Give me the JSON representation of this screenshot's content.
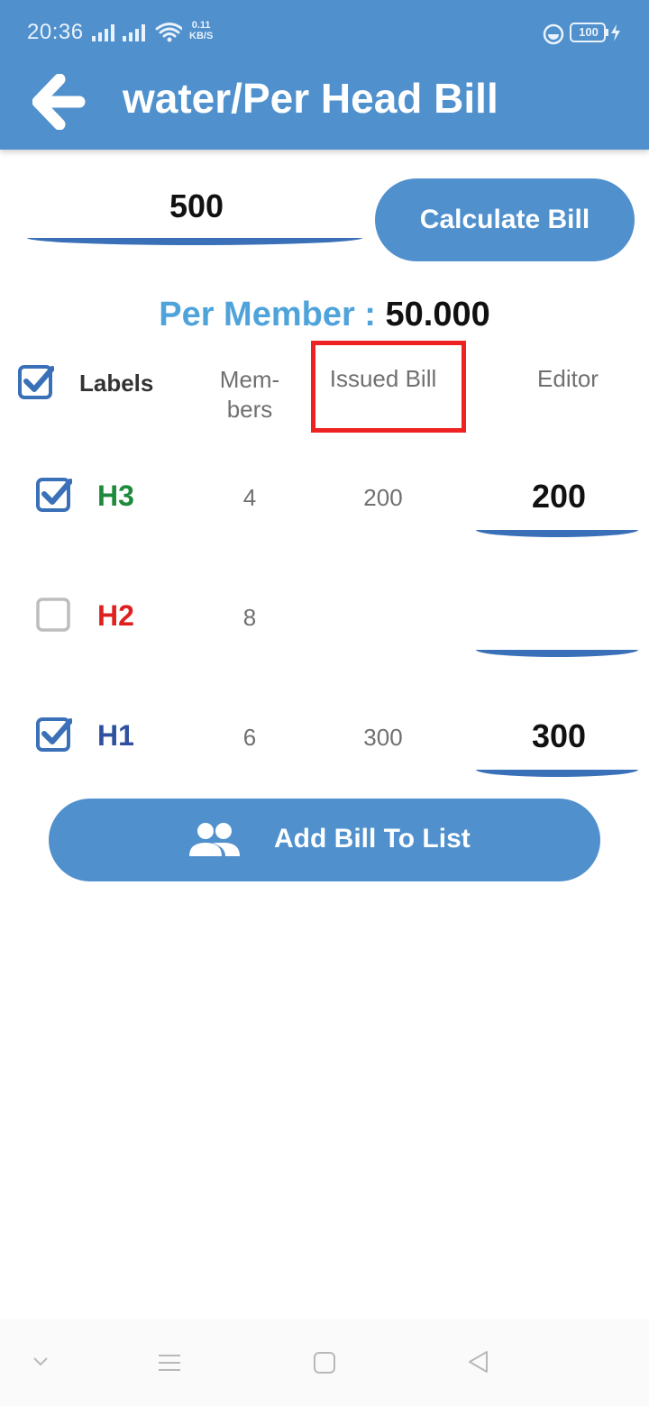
{
  "status_bar": {
    "time": "20:36",
    "speed_value": "0.11",
    "speed_unit": "KB/S",
    "battery": "100"
  },
  "app_bar": {
    "title": "water/Per Head Bill",
    "back_icon": "arrow-left-icon"
  },
  "bill_input": {
    "value": "500"
  },
  "calculate_button": {
    "label": "Calculate Bill"
  },
  "per_member": {
    "label": "Per Member : ",
    "value": "50.000"
  },
  "table_header": {
    "select_all_checked": true,
    "labels": "Labels",
    "members_line1": "Mem-",
    "members_line2": "bers",
    "issued_bill": "Issued Bill",
    "editor": "Editor"
  },
  "rows": [
    {
      "label": "H3",
      "label_color": "#1e8a3c",
      "checked": true,
      "members": "4",
      "issued_bill": "200",
      "editor_value": "200"
    },
    {
      "label": "H2",
      "label_color": "#e02020",
      "checked": false,
      "members": "8",
      "issued_bill": "",
      "editor_value": ""
    },
    {
      "label": "H1",
      "label_color": "#2f4fa0",
      "checked": true,
      "members": "6",
      "issued_bill": "300",
      "editor_value": "300"
    }
  ],
  "add_button": {
    "label": "Add Bill To List",
    "icon": "people-icon"
  },
  "colors": {
    "primary": "#4f90cd",
    "underline": "#3a70b8",
    "per_member_label": "#4fa3db",
    "highlight": "#ee2222"
  },
  "nav_bar": {
    "icons": [
      "chevron-down-icon",
      "menu-icon",
      "home-square-icon",
      "back-triangle-icon"
    ]
  }
}
